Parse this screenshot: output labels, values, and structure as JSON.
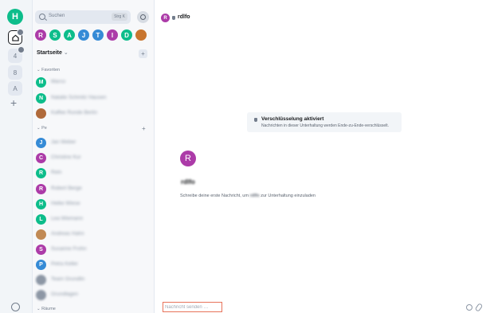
{
  "user": {
    "initial": "H",
    "color": "#0dbd8b"
  },
  "spaces": [
    {
      "label": "",
      "active": true,
      "icon": "home-icon"
    },
    {
      "label": "4",
      "badge": true
    },
    {
      "label": "8"
    },
    {
      "label": "A"
    }
  ],
  "search": {
    "placeholder": "Suchen",
    "shortcut": "Strg K"
  },
  "recents": [
    {
      "initial": "R",
      "color": "#ac3ba8"
    },
    {
      "initial": "S",
      "color": "#0dbd8b"
    },
    {
      "initial": "A",
      "color": "#0dbd8b"
    },
    {
      "initial": "J",
      "color": "#368bd6"
    },
    {
      "initial": "T",
      "color": "#368bd6"
    },
    {
      "initial": "I",
      "color": "#ac3ba8"
    },
    {
      "initial": "D",
      "color": "#0dbd8b"
    },
    {
      "initial": "",
      "color": "#c8752f"
    }
  ],
  "home": {
    "title": "Startseite",
    "caret": "⌄"
  },
  "sections": {
    "favorites": "⌄ Favoriten",
    "people": "⌄ Pe",
    "rooms": "⌄ Räume"
  },
  "favorites": [
    {
      "initial": "M",
      "color": "#0dbd8b",
      "name": "Marco"
    },
    {
      "initial": "N",
      "color": "#0dbd8b",
      "name": "Natalie Schmitz Hausen"
    },
    {
      "initial": "",
      "color": "#b06a3b",
      "name": "Kaffee Runde Berlin"
    }
  ],
  "people": [
    {
      "initial": "J",
      "color": "#368bd6",
      "name": "Jan Weber"
    },
    {
      "initial": "C",
      "color": "#ac3ba8",
      "name": "Christine Kur"
    },
    {
      "initial": "R",
      "color": "#0dbd8b",
      "name": "Rein"
    },
    {
      "initial": "R",
      "color": "#ac3ba8",
      "name": "Robert Berge"
    },
    {
      "initial": "H",
      "color": "#0dbd8b",
      "name": "Heike Wiese"
    },
    {
      "initial": "L",
      "color": "#0dbd8b",
      "name": "Lea Wiemann"
    },
    {
      "initial": "",
      "color": "#c18a55",
      "name": "Andreas Hahn"
    },
    {
      "initial": "S",
      "color": "#ac3ba8",
      "name": "Susanne Frohn"
    },
    {
      "initial": "P",
      "color": "#368bd6",
      "name": "Petra Keller"
    },
    {
      "initial": "",
      "color": "#8d97a5",
      "name": "Team Grundlin"
    },
    {
      "initial": "",
      "color": "#8d97a5",
      "name": "Grundlagen"
    }
  ],
  "sidebar_footer": "⌄ Räume",
  "room": {
    "initial": "R",
    "name": "rdlfo",
    "color": "#ac3ba8"
  },
  "encryption": {
    "title": "Verschlüsselung aktiviert",
    "subtitle": "Nachrichten in dieser Unterhaltung werden Ende-zu-Ende-verschlüsselt."
  },
  "intro": {
    "initial": "R",
    "name": "rdlfo",
    "text_before": "Schreibe deine erste Nachricht, um ",
    "name_inline": "rdlfo",
    "text_after": " zur Unterhaltung einzuladen"
  },
  "composer": {
    "placeholder": "Nachricht senden …"
  }
}
